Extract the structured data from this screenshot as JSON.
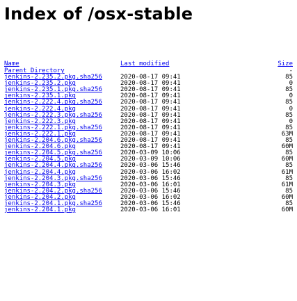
{
  "page_title": "Index of /osx-stable",
  "columns": {
    "name": "Name",
    "last_modified": "Last modified",
    "size": "Size"
  },
  "parent": {
    "label": "Parent Directory",
    "size": "-"
  },
  "files": [
    {
      "name": "jenkins-2.235.2.pkg.sha256",
      "modified": "2020-08-17 09:41",
      "size": "85"
    },
    {
      "name": "jenkins-2.235.2.pkg",
      "modified": "2020-08-17 09:41",
      "size": "0"
    },
    {
      "name": "jenkins-2.235.1.pkg.sha256",
      "modified": "2020-08-17 09:41",
      "size": "85"
    },
    {
      "name": "jenkins-2.235.1.pkg",
      "modified": "2020-08-17 09:41",
      "size": "0"
    },
    {
      "name": "jenkins-2.222.4.pkg.sha256",
      "modified": "2020-08-17 09:41",
      "size": "85"
    },
    {
      "name": "jenkins-2.222.4.pkg",
      "modified": "2020-08-17 09:41",
      "size": "0"
    },
    {
      "name": "jenkins-2.222.3.pkg.sha256",
      "modified": "2020-08-17 09:41",
      "size": "85"
    },
    {
      "name": "jenkins-2.222.3.pkg",
      "modified": "2020-08-17 09:41",
      "size": "0"
    },
    {
      "name": "jenkins-2.222.1.pkg.sha256",
      "modified": "2020-08-17 09:41",
      "size": "85"
    },
    {
      "name": "jenkins-2.222.1.pkg",
      "modified": "2020-08-17 09:41",
      "size": "63M"
    },
    {
      "name": "jenkins-2.204.6.pkg.sha256",
      "modified": "2020-08-17 09:41",
      "size": "85"
    },
    {
      "name": "jenkins-2.204.6.pkg",
      "modified": "2020-08-17 09:41",
      "size": "60M"
    },
    {
      "name": "jenkins-2.204.5.pkg.sha256",
      "modified": "2020-03-09 10:06",
      "size": "85"
    },
    {
      "name": "jenkins-2.204.5.pkg",
      "modified": "2020-03-09 10:06",
      "size": "60M"
    },
    {
      "name": "jenkins-2.204.4.pkg.sha256",
      "modified": "2020-03-06 15:46",
      "size": "85"
    },
    {
      "name": "jenkins-2.204.4.pkg",
      "modified": "2020-03-06 16:02",
      "size": "61M"
    },
    {
      "name": "jenkins-2.204.3.pkg.sha256",
      "modified": "2020-03-06 15:46",
      "size": "85"
    },
    {
      "name": "jenkins-2.204.3.pkg",
      "modified": "2020-03-06 16:01",
      "size": "61M"
    },
    {
      "name": "jenkins-2.204.2.pkg.sha256",
      "modified": "2020-03-06 15:46",
      "size": "85"
    },
    {
      "name": "jenkins-2.204.2.pkg",
      "modified": "2020-03-06 16:02",
      "size": "60M"
    },
    {
      "name": "jenkins-2.204.1.pkg.sha256",
      "modified": "2020-03-06 15:46",
      "size": "85"
    },
    {
      "name": "jenkins-2.204.1.pkg",
      "modified": "2020-03-06 16:01",
      "size": "60M"
    }
  ]
}
